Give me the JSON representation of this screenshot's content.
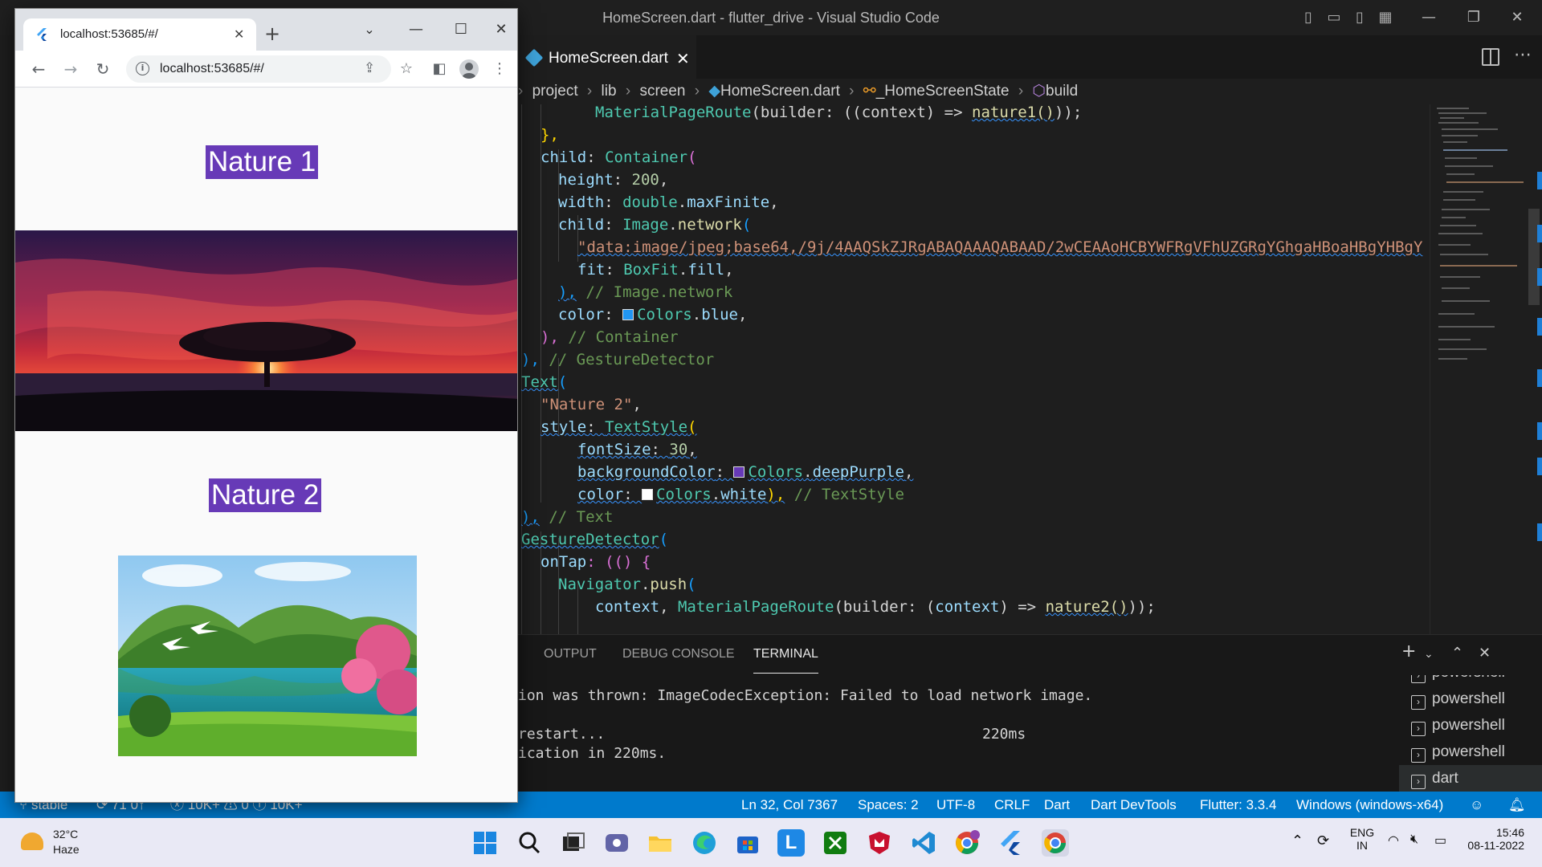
{
  "vscode": {
    "window_title": "HomeScreen.dart - flutter_drive - Visual Studio Code",
    "tab": {
      "label": "HomeScreen.dart"
    },
    "breadcrumb": [
      "project",
      "lib",
      "screen",
      "HomeScreen.dart",
      "_HomeScreenState",
      "build"
    ],
    "panel": {
      "tabs": [
        "OUTPUT",
        "DEBUG CONSOLE",
        "TERMINAL"
      ],
      "active_tab": "TERMINAL",
      "terminal_lines": [
        "ion was thrown: ImageCodecException: Failed to load network image.",
        "",
        "restart...",
        "ication in 220ms."
      ],
      "restart_time": "220ms",
      "terminals": [
        "powershell",
        "powershell",
        "powershell",
        "powershell",
        "dart"
      ]
    },
    "status": {
      "branch": "stable",
      "sync": "71 0↑",
      "errors": "10K+",
      "warnings": "0",
      "info": "10K+",
      "cursor": "Ln 32, Col 7367",
      "spaces": "Spaces: 2",
      "encoding": "UTF-8",
      "eol": "CRLF",
      "language": "Dart",
      "devtools": "Dart DevTools",
      "flutter": "Flutter: 3.3.4",
      "device": "Windows (windows-x64)"
    },
    "colors": {
      "accent": "#007acc",
      "editor_bg": "#1e1e1e"
    }
  },
  "code": {
    "l1_a": "MaterialPageRoute",
    "l1_b": "(builder: ((context) => ",
    "l1_c": "nature1()",
    "l1_d": "));",
    "l2": "},",
    "l3_a": "child",
    "l3_b": ": ",
    "l3_c": "Container",
    "l3_d": "(",
    "l4_a": "height",
    "l4_b": ": ",
    "l4_c": "200",
    "l4_d": ",",
    "l5_a": "width",
    "l5_b": ": ",
    "l5_c": "double",
    "l5_d": ".",
    "l5_e": "maxFinite",
    "l5_f": ",",
    "l6_a": "child",
    "l6_b": ": ",
    "l6_c": "Image",
    "l6_d": ".",
    "l6_e": "network",
    "l6_f": "(",
    "l7": "\"data:image/jpeg;base64,/9j/4AAQSkZJRgABAQAAAQABAAD/2wCEAAoHCBYWFRgVFhUZGRgYGhgaHBoaHBgYHBgY",
    "l8_a": "fit",
    "l8_b": ": ",
    "l8_c": "BoxFit",
    "l8_d": ".",
    "l8_e": "fill",
    "l8_f": ",",
    "l9_a": "),",
    "l9_b": " // Image.network",
    "l10_a": "color",
    "l10_b": ": ",
    "l10_c": "Colors",
    "l10_d": ".",
    "l10_e": "blue",
    "l10_f": ",",
    "l11_a": "),",
    "l11_b": " // Container",
    "l12_a": "),",
    "l12_b": " // GestureDetector",
    "l13_a": "Text",
    "l13_b": "(",
    "l14": "\"Nature 2\"",
    "l14_b": ",",
    "l15_a": "style",
    "l15_b": ": ",
    "l15_c": "TextStyle",
    "l15_d": "(",
    "l16_a": "fontSize",
    "l16_b": ": ",
    "l16_c": "30",
    "l16_d": ",",
    "l17_a": "backgroundColor",
    "l17_b": ": ",
    "l17_c": "Colors",
    "l17_d": ".",
    "l17_e": "deepPurple",
    "l17_f": ",",
    "l18_a": "color",
    "l18_b": ": ",
    "l18_c": "Colors",
    "l18_d": ".",
    "l18_e": "white",
    "l18_f": "),",
    "l18_g": " // TextStyle",
    "l19_a": "),",
    "l19_b": " // Text",
    "l20_a": "GestureDetector",
    "l20_b": "(",
    "l21_a": "onTap",
    "l21_b": ": (() {",
    "l22_a": "Navigator",
    "l22_b": ".",
    "l22_c": "push",
    "l22_d": "(",
    "l23_a": "context",
    "l23_b": ", ",
    "l23_c": "MaterialPageRoute",
    "l23_d": "(builder: (",
    "l23_e": "context",
    "l23_f": ") => ",
    "l23_g": "nature2()",
    "l23_h": "));"
  },
  "browser": {
    "tab_title": "localhost:53685/#/",
    "url": "localhost:53685/#/",
    "page": {
      "title1": "Nature 1",
      "title2": "Nature 2"
    }
  },
  "taskbar": {
    "weather_temp": "32°C",
    "weather_desc": "Haze",
    "lang_top": "ENG",
    "lang_bottom": "IN",
    "time": "15:46",
    "date": "08-11-2022"
  }
}
